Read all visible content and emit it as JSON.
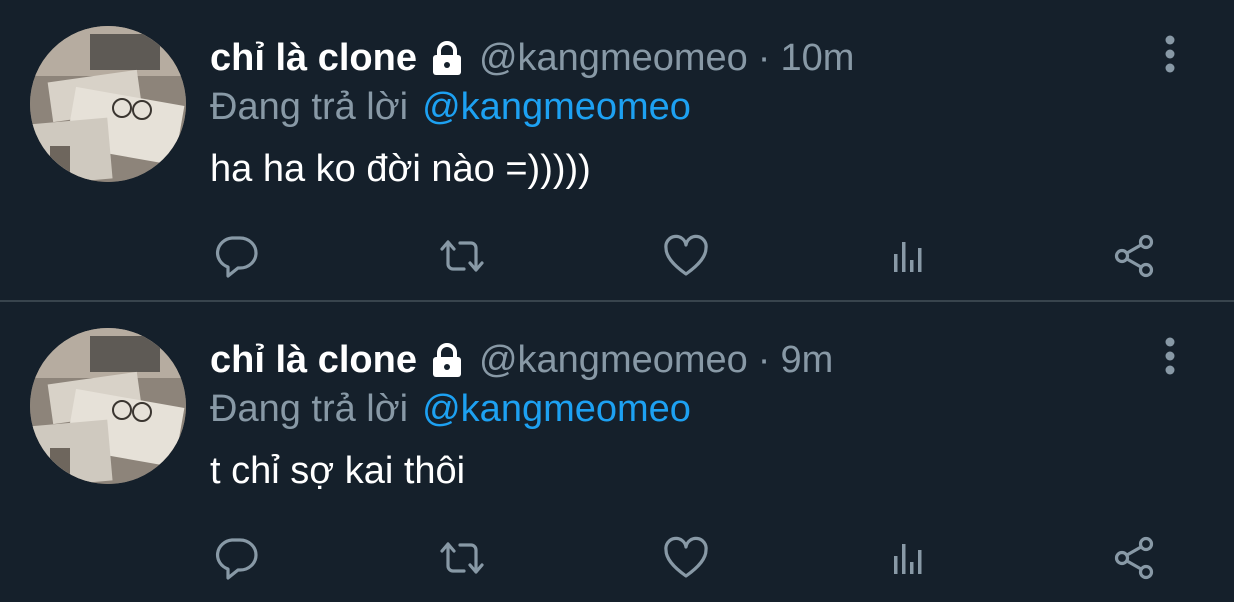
{
  "tweets": [
    {
      "author_name": "chỉ là clone",
      "handle": "@kangmeomeo",
      "separator": "·",
      "time": "10m",
      "reply_prefix": "Đang trả lời",
      "reply_to": "@kangmeomeo",
      "text": "ha ha ko đời nào =)))))"
    },
    {
      "author_name": "chỉ là clone",
      "handle": "@kangmeomeo",
      "separator": "·",
      "time": "9m",
      "reply_prefix": "Đang trả lời",
      "reply_to": "@kangmeomeo",
      "text": "t chỉ sợ kai thôi"
    }
  ],
  "icons": {
    "protected": "lock-icon",
    "more": "more-vertical-icon",
    "reply": "reply-bubble-icon",
    "retweet": "retweet-icon",
    "like": "heart-icon",
    "analytics": "bar-chart-icon",
    "share": "share-icon"
  },
  "colors": {
    "background": "#15202b",
    "divider": "#38444d",
    "primary_text": "#ffffff",
    "secondary_text": "#8899a6",
    "link": "#1da1f2"
  }
}
